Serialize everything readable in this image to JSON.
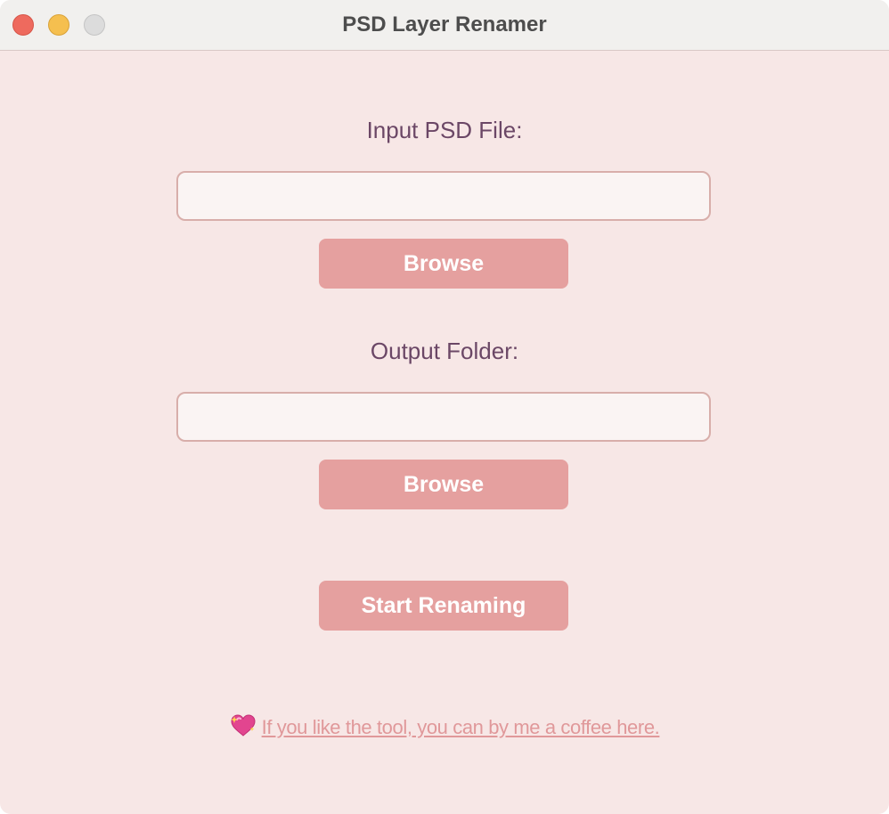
{
  "window": {
    "title": "PSD Layer Renamer",
    "controls": [
      "close",
      "minimize",
      "zoom"
    ]
  },
  "input_section": {
    "label": "Input PSD File:",
    "value": "",
    "browse_label": "Browse"
  },
  "output_section": {
    "label": "Output Folder:",
    "value": "",
    "browse_label": "Browse"
  },
  "start_button": {
    "label": "Start Renaming"
  },
  "coffee_link": {
    "icon": "sparkling-heart-icon",
    "text": "If you like the tool, you can by me a coffee here."
  },
  "colors": {
    "background": "#f7e7e6",
    "button": "#e5a09f",
    "label": "#6b4766",
    "link": "#e0989a"
  }
}
